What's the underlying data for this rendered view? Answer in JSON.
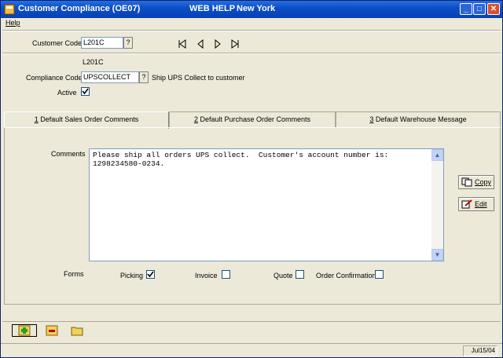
{
  "title": {
    "app_title": "Customer Compliance (OE07)",
    "help_text": "WEB HELP",
    "location": "New York",
    "minimize_label": "_",
    "maximize_label": "□",
    "close_label": "✕"
  },
  "menu": {
    "help": "Help"
  },
  "form": {
    "customer_code_label": "Customer Code",
    "customer_code_value": "L201C",
    "lookup_label": "?",
    "customer_name": "L201C",
    "compliance_code_label": "Compliance Code",
    "compliance_code_value": "UPSCOLLECT",
    "compliance_description": "Ship UPS Collect to customer",
    "active_label": "Active",
    "active_checked": true
  },
  "tabs": [
    {
      "key": "1",
      "label": " Default Sales Order Comments",
      "active": true
    },
    {
      "key": "2",
      "label": " Default Purchase Order Comments",
      "active": false
    },
    {
      "key": "3",
      "label": " Default Warehouse Message",
      "active": false
    }
  ],
  "comments": {
    "label": "Comments",
    "text": "Please ship all orders UPS collect.  Customer's account number is:\n1298234580-0234."
  },
  "buttons": {
    "copy": "Copy",
    "edit": "Edit"
  },
  "forms": {
    "label": "Forms",
    "picking": {
      "label": "Picking",
      "checked": true
    },
    "invoice": {
      "label": "Invoice",
      "checked": false
    },
    "quote": {
      "label": "Quote",
      "checked": false
    },
    "order_confirmation": {
      "label": "Order Confirmation",
      "checked": false
    }
  },
  "status": {
    "date": "Jul15/04"
  },
  "icons": {
    "app": "app-icon",
    "nav_first": "first-record-icon",
    "nav_prev": "previous-record-icon",
    "nav_next": "next-record-icon",
    "nav_last": "last-record-icon",
    "add": "add-record-icon",
    "delete": "delete-record-icon",
    "open": "folder-icon"
  },
  "colors": {
    "title_bar": "#0b4fc8",
    "window_bg": "#ece9d8",
    "check_mark": "#21a121"
  }
}
